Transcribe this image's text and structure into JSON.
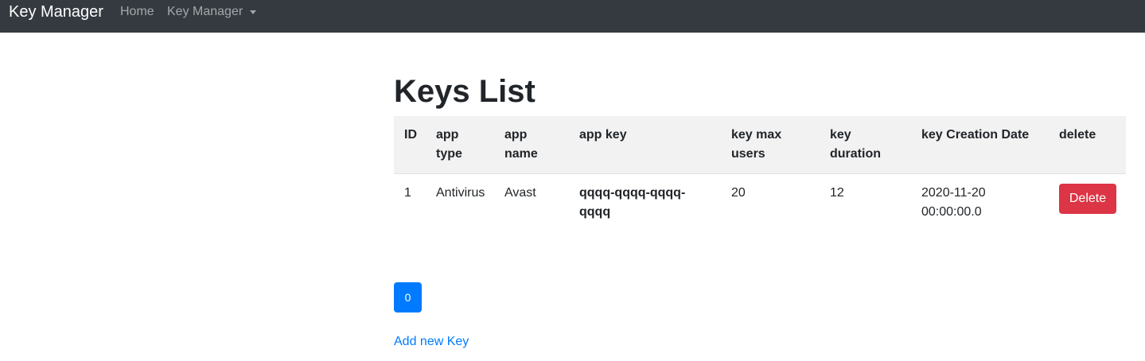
{
  "navbar": {
    "brand": "Key Manager",
    "home": "Home",
    "dropdown": "Key Manager"
  },
  "page": {
    "title": "Keys List"
  },
  "table": {
    "headers": {
      "id": "ID",
      "app_type_1": "app",
      "app_type_2": "type",
      "app_name_1": "app",
      "app_name_2": "name",
      "app_key": "app key",
      "max_users_1": "key max",
      "max_users_2": "users",
      "duration_1": "key",
      "duration_2": "duration",
      "creation_date": "key Creation Date",
      "delete": "delete"
    },
    "rows": [
      {
        "id": "1",
        "app_type": "Antivirus",
        "app_name": "Avast",
        "app_key_1": "qqqq-qqqq-qqqq-",
        "app_key_2": "qqqq",
        "max_users": "20",
        "duration": "12",
        "creation_date_1": "2020-11-20",
        "creation_date_2": "00:00:00.0",
        "delete_label": "Delete"
      }
    ]
  },
  "pagination": {
    "page": "0"
  },
  "links": {
    "add_new": "Add new Key"
  },
  "colors": {
    "navbar": "#343a40",
    "primary": "#007bff",
    "danger": "#dc3545",
    "table_header": "#f2f2f2"
  }
}
